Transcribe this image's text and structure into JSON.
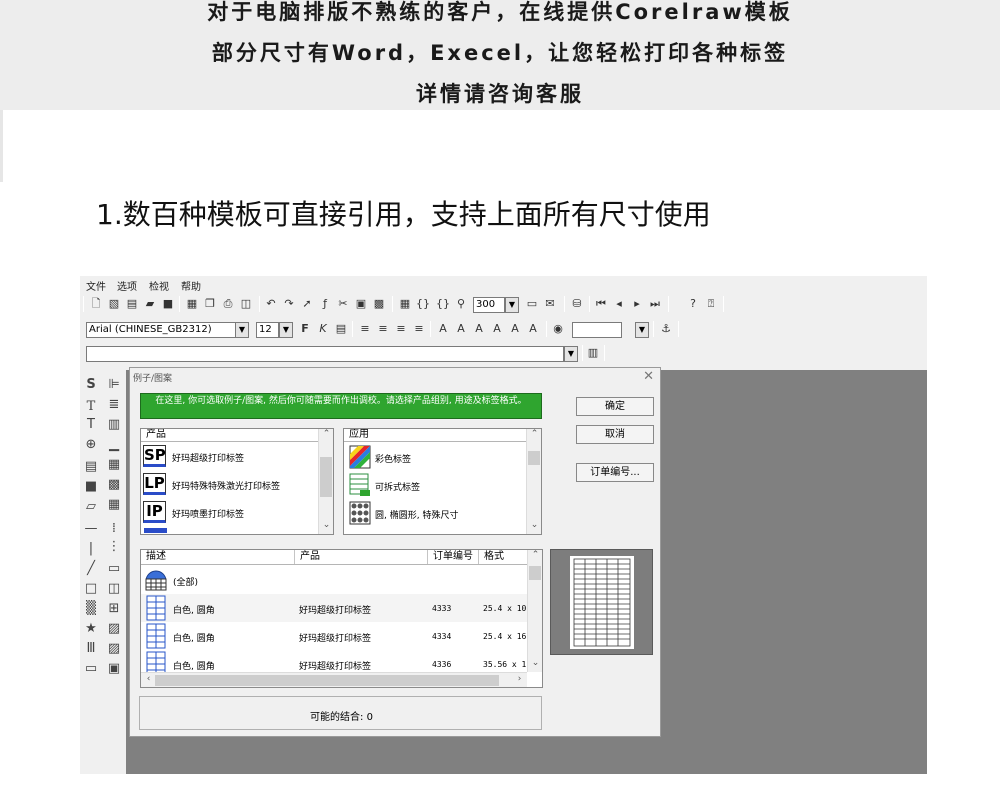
{
  "banner": {
    "line1": "对于电脑排版不熟练的客户，在线提供Corelraw模板",
    "line2": "部分尺寸有Word，Execel，让您轻松打印各种标签",
    "line3": "详情请咨询客服"
  },
  "headline": "1.数百种模板可直接引用，支持上面所有尺寸使用",
  "app": {
    "menu": [
      "文件",
      "选项",
      "检视",
      "帮助"
    ],
    "toolbar": {
      "zoom_value": "300",
      "font_name": "Arial (CHINESE_GB2312)",
      "font_size": "12",
      "text_field_value": ""
    },
    "dialog": {
      "title": "例子/图案",
      "instruction": "在这里, 你可选取例子/图案, 然后你可随需要而作出调校。请选择产品组别, 用途及标签格式。",
      "ok_label": "确定",
      "cancel_label": "取消",
      "order_number_label": "订单编号...",
      "product_header": "产品",
      "products": [
        {
          "code": "SP",
          "name": "好玛超级打印标签"
        },
        {
          "code": "LP",
          "name": "好玛特殊特殊激光打印标签"
        },
        {
          "code": "IP",
          "name": "好玛喷墨打印标签"
        }
      ],
      "application_header": "应用",
      "applications": [
        {
          "icon": "color-label-icon",
          "name": "彩色标签"
        },
        {
          "icon": "removable-label-icon",
          "name": "可拆式标签"
        },
        {
          "icon": "round-oval-icon",
          "name": "圆, 椭圆形, 特殊尺寸"
        }
      ],
      "table_headers": {
        "description": "描述",
        "product": "产品",
        "order_no": "订单编号",
        "format": "格式"
      },
      "all_label": "(全部)",
      "rows": [
        {
          "description": "白色, 圆角",
          "product": "好玛超级打印标签",
          "order_no": "4333",
          "format": "25.4 x 10"
        },
        {
          "description": "白色, 圆角",
          "product": "好玛超级打印标签",
          "order_no": "4334",
          "format": "25.4 x 16"
        },
        {
          "description": "白色, 圆角",
          "product": "好玛超级打印标签",
          "order_no": "4336",
          "format": "35.56 x 1"
        }
      ],
      "status": "可能的结合: 0"
    }
  }
}
